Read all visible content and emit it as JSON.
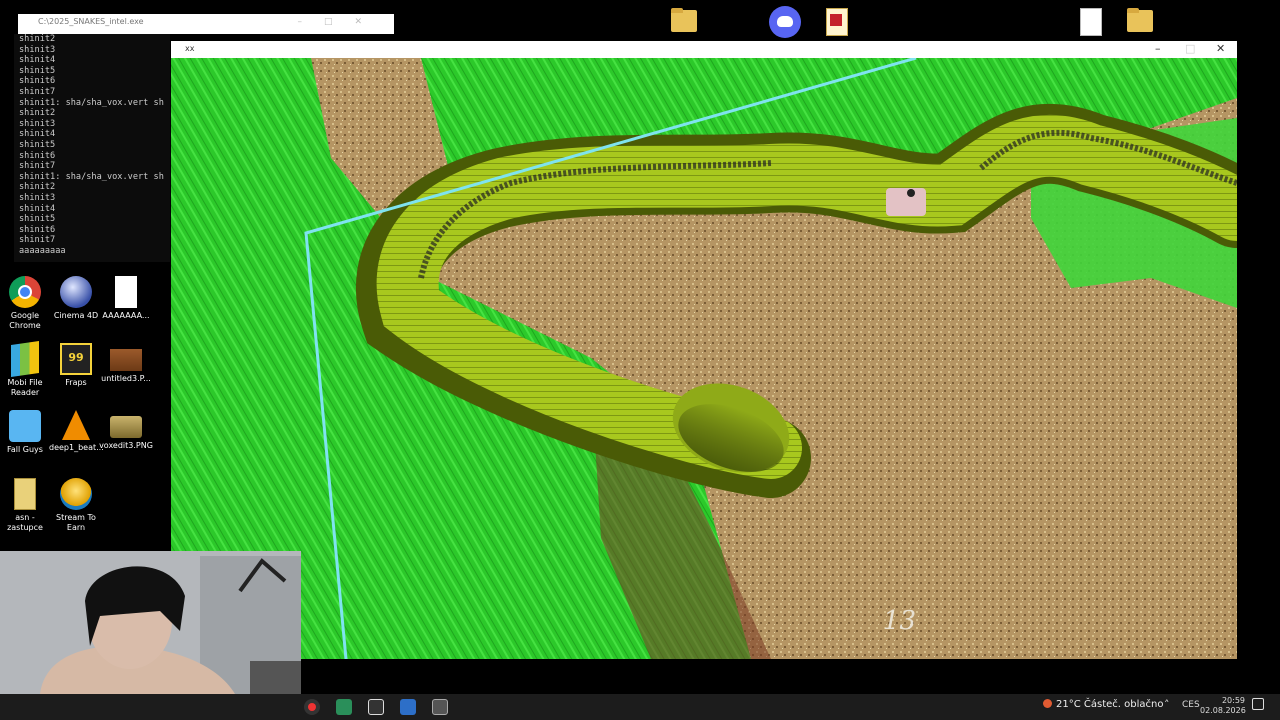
{
  "console": {
    "title": "C:\\2025_SNAKES_intel.exe",
    "lines": [
      "shinit2",
      "shinit3",
      "shinit4",
      "shinit5",
      "shinit6",
      "shinit7",
      "shinit1: sha/sha_vox.vert sh",
      "shinit2",
      "shinit3",
      "shinit4",
      "shinit5",
      "shinit6",
      "shinit7",
      "shinit1: sha/sha_vox.vert sh",
      "shinit2",
      "shinit3",
      "shinit4",
      "shinit5",
      "shinit6",
      "shinit7",
      "aaaaaaaaa"
    ]
  },
  "desktop_icons": [
    {
      "label": "Google Chrome",
      "icon": "chrome-icon"
    },
    {
      "label": "Cinema 4D",
      "icon": "cinema4d-icon"
    },
    {
      "label": "AAAAAAA...",
      "icon": "file-icon"
    },
    {
      "label": "Mobi File Reader",
      "icon": "mobi-icon"
    },
    {
      "label": "Fraps",
      "icon": "fraps-icon"
    },
    {
      "label": "untitled3.P...",
      "icon": "image-icon"
    },
    {
      "label": "Fall Guys",
      "icon": "fallguys-icon"
    },
    {
      "label": "deep1_beat...",
      "icon": "vlc-icon"
    },
    {
      "label": "voxedit3.PNG",
      "icon": "image-icon"
    },
    {
      "label": "asn - zastupce",
      "icon": "file-icon"
    },
    {
      "label": "Stream To Earn",
      "icon": "stream-icon"
    }
  ],
  "game": {
    "window_title": "xx",
    "score": "13",
    "colors": {
      "grass": "#2fcf2c",
      "sand": "#b79863",
      "snake": "#9fc21d",
      "snake_dark": "#5a6d08",
      "border": "#7fe3ef"
    }
  },
  "taskbar": {
    "weather": "21°C  Částeč. oblačno",
    "lang": "CES",
    "time": "20:59",
    "date": "02.08.2026"
  }
}
